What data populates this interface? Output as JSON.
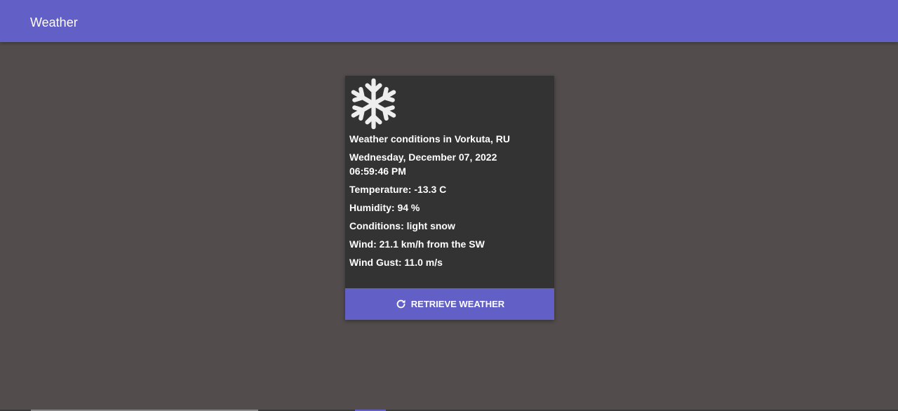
{
  "app_bar": {
    "title": "Weather"
  },
  "weather_card": {
    "icon": "snowflake-icon",
    "location_line": "Weather conditions in Vorkuta, RU",
    "date_line": "Wednesday, December 07, 2022",
    "time_line": "06:59:46 PM",
    "temperature_line": "Temperature: -13.3 C",
    "humidity_line": "Humidity: 94 %",
    "conditions_line": "Conditions: light snow",
    "wind_line": "Wind: 21.1 km/h from the SW",
    "wind_gust_line": "Wind Gust: 11.0 m/s",
    "button": {
      "icon": "refresh-icon",
      "label": "RETRIEVE WEATHER"
    }
  },
  "colors": {
    "app_bar": "#625fc6",
    "page_background": "#524c4c",
    "card_background": "#333333",
    "text": "#ffffff"
  }
}
